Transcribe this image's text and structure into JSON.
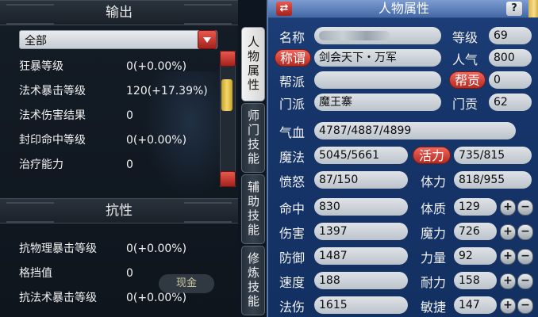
{
  "left": {
    "output_header": "输出",
    "filter_value": "全部",
    "output_stats": [
      {
        "label": "狂暴等级",
        "value": "0(+0.00%)"
      },
      {
        "label": "法术暴击等级",
        "value": "120(+17.39%)"
      },
      {
        "label": "法术伤害结果",
        "value": "0"
      },
      {
        "label": "封印命中等级",
        "value": "0(+0.00%)"
      },
      {
        "label": "治疗能力",
        "value": "0"
      }
    ],
    "resist_header": "抗性",
    "resist_stats": [
      {
        "label": "抗物理暴击等级",
        "value": "0(+0.00%)"
      },
      {
        "label": "格挡值",
        "value": "0"
      },
      {
        "label": "抗法术暴击等级",
        "value": "0(+0.00%)"
      }
    ],
    "bg_tag": "现金"
  },
  "tabs": [
    "人物属性",
    "师门技能",
    "辅助技能",
    "修炼技能"
  ],
  "right": {
    "title": "人物属性",
    "help_label": "?",
    "name_label": "名称",
    "level_label": "等级",
    "level_value": "69",
    "title_button": "称谓",
    "title_value": "剑会天下・万军",
    "popularity_label": "人气",
    "popularity_value": "800",
    "faction_label": "帮派",
    "faction_value": "",
    "contribution_button": "帮贡",
    "contribution_value": "0",
    "sect_label": "门派",
    "sect_value": "魔王寨",
    "sect_contribution_label": "门贡",
    "sect_contribution_value": "62",
    "hp_label": "气血",
    "hp_value": "4787/4887/4899",
    "mp_label": "魔法",
    "mp_value": "5045/5661",
    "vitality_button": "活力",
    "vitality_value": "735/815",
    "rage_label": "愤怒",
    "rage_value": "87/150",
    "stamina_label": "体力",
    "stamina_value": "818/955",
    "combat": [
      {
        "label": "命中",
        "value": "830"
      },
      {
        "label": "伤害",
        "value": "1397"
      },
      {
        "label": "防御",
        "value": "1487"
      },
      {
        "label": "速度",
        "value": "188"
      },
      {
        "label": "法伤",
        "value": "1615"
      }
    ],
    "attributes": [
      {
        "label": "体质",
        "value": "129"
      },
      {
        "label": "魔力",
        "value": "726"
      },
      {
        "label": "力量",
        "value": "92"
      },
      {
        "label": "耐力",
        "value": "158"
      },
      {
        "label": "敏捷",
        "value": "147"
      }
    ],
    "plus": "+",
    "minus": "−"
  }
}
